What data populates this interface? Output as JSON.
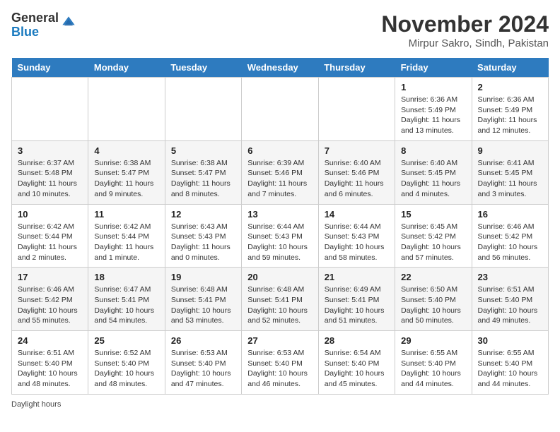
{
  "header": {
    "logo_general": "General",
    "logo_blue": "Blue",
    "month": "November 2024",
    "location": "Mirpur Sakro, Sindh, Pakistan"
  },
  "days_of_week": [
    "Sunday",
    "Monday",
    "Tuesday",
    "Wednesday",
    "Thursday",
    "Friday",
    "Saturday"
  ],
  "weeks": [
    [
      {
        "day": "",
        "info": ""
      },
      {
        "day": "",
        "info": ""
      },
      {
        "day": "",
        "info": ""
      },
      {
        "day": "",
        "info": ""
      },
      {
        "day": "",
        "info": ""
      },
      {
        "day": "1",
        "info": "Sunrise: 6:36 AM\nSunset: 5:49 PM\nDaylight: 11 hours and 13 minutes."
      },
      {
        "day": "2",
        "info": "Sunrise: 6:36 AM\nSunset: 5:49 PM\nDaylight: 11 hours and 12 minutes."
      }
    ],
    [
      {
        "day": "3",
        "info": "Sunrise: 6:37 AM\nSunset: 5:48 PM\nDaylight: 11 hours and 10 minutes."
      },
      {
        "day": "4",
        "info": "Sunrise: 6:38 AM\nSunset: 5:47 PM\nDaylight: 11 hours and 9 minutes."
      },
      {
        "day": "5",
        "info": "Sunrise: 6:38 AM\nSunset: 5:47 PM\nDaylight: 11 hours and 8 minutes."
      },
      {
        "day": "6",
        "info": "Sunrise: 6:39 AM\nSunset: 5:46 PM\nDaylight: 11 hours and 7 minutes."
      },
      {
        "day": "7",
        "info": "Sunrise: 6:40 AM\nSunset: 5:46 PM\nDaylight: 11 hours and 6 minutes."
      },
      {
        "day": "8",
        "info": "Sunrise: 6:40 AM\nSunset: 5:45 PM\nDaylight: 11 hours and 4 minutes."
      },
      {
        "day": "9",
        "info": "Sunrise: 6:41 AM\nSunset: 5:45 PM\nDaylight: 11 hours and 3 minutes."
      }
    ],
    [
      {
        "day": "10",
        "info": "Sunrise: 6:42 AM\nSunset: 5:44 PM\nDaylight: 11 hours and 2 minutes."
      },
      {
        "day": "11",
        "info": "Sunrise: 6:42 AM\nSunset: 5:44 PM\nDaylight: 11 hours and 1 minute."
      },
      {
        "day": "12",
        "info": "Sunrise: 6:43 AM\nSunset: 5:43 PM\nDaylight: 11 hours and 0 minutes."
      },
      {
        "day": "13",
        "info": "Sunrise: 6:44 AM\nSunset: 5:43 PM\nDaylight: 10 hours and 59 minutes."
      },
      {
        "day": "14",
        "info": "Sunrise: 6:44 AM\nSunset: 5:43 PM\nDaylight: 10 hours and 58 minutes."
      },
      {
        "day": "15",
        "info": "Sunrise: 6:45 AM\nSunset: 5:42 PM\nDaylight: 10 hours and 57 minutes."
      },
      {
        "day": "16",
        "info": "Sunrise: 6:46 AM\nSunset: 5:42 PM\nDaylight: 10 hours and 56 minutes."
      }
    ],
    [
      {
        "day": "17",
        "info": "Sunrise: 6:46 AM\nSunset: 5:42 PM\nDaylight: 10 hours and 55 minutes."
      },
      {
        "day": "18",
        "info": "Sunrise: 6:47 AM\nSunset: 5:41 PM\nDaylight: 10 hours and 54 minutes."
      },
      {
        "day": "19",
        "info": "Sunrise: 6:48 AM\nSunset: 5:41 PM\nDaylight: 10 hours and 53 minutes."
      },
      {
        "day": "20",
        "info": "Sunrise: 6:48 AM\nSunset: 5:41 PM\nDaylight: 10 hours and 52 minutes."
      },
      {
        "day": "21",
        "info": "Sunrise: 6:49 AM\nSunset: 5:41 PM\nDaylight: 10 hours and 51 minutes."
      },
      {
        "day": "22",
        "info": "Sunrise: 6:50 AM\nSunset: 5:40 PM\nDaylight: 10 hours and 50 minutes."
      },
      {
        "day": "23",
        "info": "Sunrise: 6:51 AM\nSunset: 5:40 PM\nDaylight: 10 hours and 49 minutes."
      }
    ],
    [
      {
        "day": "24",
        "info": "Sunrise: 6:51 AM\nSunset: 5:40 PM\nDaylight: 10 hours and 48 minutes."
      },
      {
        "day": "25",
        "info": "Sunrise: 6:52 AM\nSunset: 5:40 PM\nDaylight: 10 hours and 48 minutes."
      },
      {
        "day": "26",
        "info": "Sunrise: 6:53 AM\nSunset: 5:40 PM\nDaylight: 10 hours and 47 minutes."
      },
      {
        "day": "27",
        "info": "Sunrise: 6:53 AM\nSunset: 5:40 PM\nDaylight: 10 hours and 46 minutes."
      },
      {
        "day": "28",
        "info": "Sunrise: 6:54 AM\nSunset: 5:40 PM\nDaylight: 10 hours and 45 minutes."
      },
      {
        "day": "29",
        "info": "Sunrise: 6:55 AM\nSunset: 5:40 PM\nDaylight: 10 hours and 44 minutes."
      },
      {
        "day": "30",
        "info": "Sunrise: 6:55 AM\nSunset: 5:40 PM\nDaylight: 10 hours and 44 minutes."
      }
    ]
  ],
  "footer": {
    "note": "Daylight hours"
  }
}
